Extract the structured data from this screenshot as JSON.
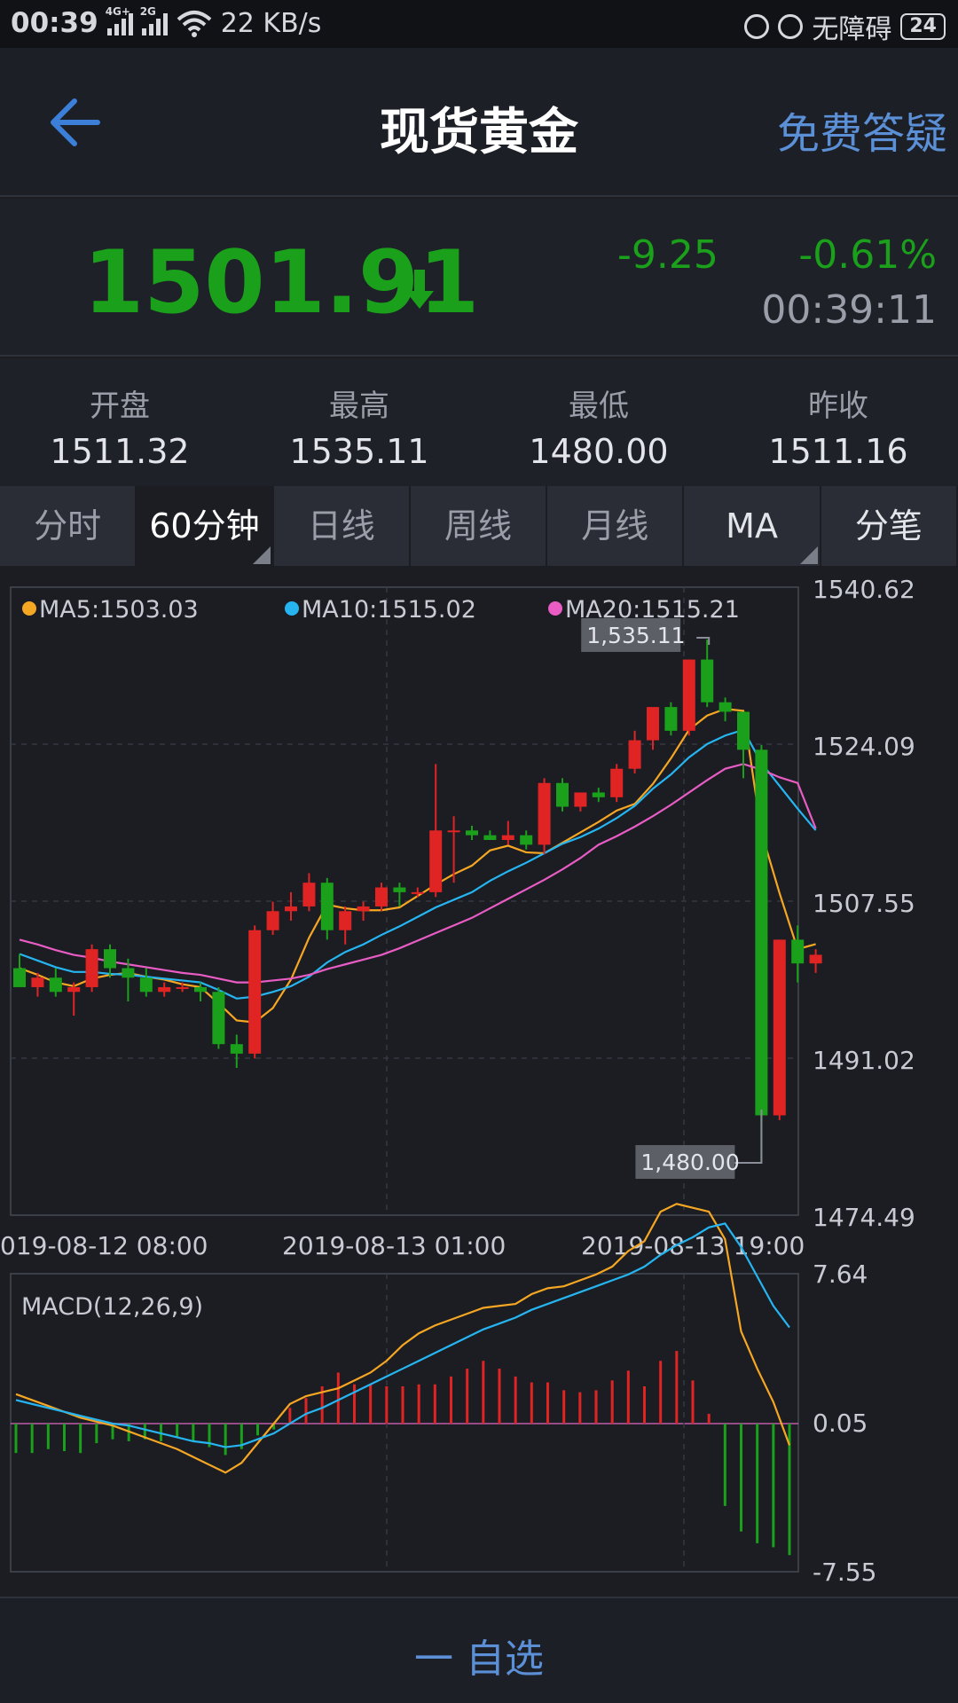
{
  "status_bar": {
    "time": "00:39",
    "network1": "4G+",
    "network2": "2G",
    "speed": "22 KB/s",
    "accessibility": "无障碍",
    "battery": "24"
  },
  "header": {
    "title": "现货黄金",
    "help_label": "免费答疑"
  },
  "quote": {
    "price": "1501.91",
    "change": "-9.25",
    "change_pct": "-0.61%",
    "time": "00:39:11",
    "down_color": "#1aa01a"
  },
  "stats": [
    {
      "label": "开盘",
      "value": "1511.32"
    },
    {
      "label": "最高",
      "value": "1535.11"
    },
    {
      "label": "最低",
      "value": "1480.00"
    },
    {
      "label": "昨收",
      "value": "1511.16"
    }
  ],
  "tabs": [
    {
      "label": "分时"
    },
    {
      "label": "60分钟"
    },
    {
      "label": "日线"
    },
    {
      "label": "周线"
    },
    {
      "label": "月线"
    },
    {
      "label": "MA"
    },
    {
      "label": "分笔"
    }
  ],
  "chart_data": [
    {
      "type": "candlestick",
      "legend": [
        {
          "label": "MA5:1503.03",
          "color": "#f5a623"
        },
        {
          "label": "MA10:1515.02",
          "color": "#26b5f0"
        },
        {
          "label": "MA20:1515.21",
          "color": "#e85cc4"
        }
      ],
      "y_ticks": [
        "1540.62",
        "1524.09",
        "1507.55",
        "1491.02",
        "1474.49"
      ],
      "ylim": [
        1474.49,
        1540.62
      ],
      "x_ticks": [
        "019-08-12 08:00",
        "2019-08-13 01:00",
        "2019-08-13 19:00"
      ],
      "max_label": "1,535.11",
      "min_label": "1,480.00",
      "up_color": "#e02424",
      "down_color": "#1aa01a",
      "candles": [
        [
          1500.5,
          1502.0,
          1499.0,
          1498.5
        ],
        [
          1498.5,
          1500.0,
          1497.5,
          1499.5
        ],
        [
          1499.5,
          1500.5,
          1497.5,
          1498.0
        ],
        [
          1498.0,
          1499.0,
          1495.5,
          1498.5
        ],
        [
          1498.5,
          1503.0,
          1498.0,
          1502.5
        ],
        [
          1502.5,
          1503.0,
          1499.5,
          1500.5
        ],
        [
          1500.5,
          1501.5,
          1497.0,
          1499.5
        ],
        [
          1499.5,
          1500.5,
          1497.5,
          1498.0
        ],
        [
          1498.0,
          1499.0,
          1497.5,
          1498.5
        ],
        [
          1498.5,
          1499.0,
          1498.0,
          1498.5
        ],
        [
          1498.5,
          1499.0,
          1497.0,
          1498.0
        ],
        [
          1498.0,
          1498.5,
          1492.0,
          1492.5
        ],
        [
          1492.5,
          1493.5,
          1490.0,
          1491.5
        ],
        [
          1491.5,
          1505.0,
          1491.0,
          1504.5
        ],
        [
          1504.5,
          1507.5,
          1504.0,
          1506.5
        ],
        [
          1506.5,
          1508.5,
          1505.5,
          1507.0
        ],
        [
          1507.0,
          1510.5,
          1506.5,
          1509.5
        ],
        [
          1509.5,
          1510.0,
          1503.5,
          1504.5
        ],
        [
          1504.5,
          1507.0,
          1503.0,
          1506.5
        ],
        [
          1506.5,
          1507.5,
          1505.5,
          1507.0
        ],
        [
          1507.0,
          1509.5,
          1506.5,
          1509.0
        ],
        [
          1509.0,
          1509.5,
          1507.0,
          1508.5
        ],
        [
          1508.5,
          1509.0,
          1508.0,
          1508.5
        ],
        [
          1508.5,
          1522.0,
          1508.0,
          1515.0
        ],
        [
          1515.0,
          1516.5,
          1509.5,
          1515.0
        ],
        [
          1515.0,
          1515.5,
          1514.0,
          1514.5
        ],
        [
          1514.5,
          1515.0,
          1514.0,
          1514.0
        ],
        [
          1514.0,
          1516.0,
          1513.5,
          1514.5
        ],
        [
          1514.5,
          1515.0,
          1513.0,
          1513.5
        ],
        [
          1513.5,
          1520.5,
          1512.5,
          1520.0
        ],
        [
          1520.0,
          1520.5,
          1517.0,
          1517.5
        ],
        [
          1517.5,
          1519.0,
          1517.0,
          1519.0
        ],
        [
          1519.0,
          1519.5,
          1518.0,
          1518.5
        ],
        [
          1518.5,
          1522.0,
          1518.0,
          1521.5
        ],
        [
          1521.5,
          1525.5,
          1521.0,
          1524.5
        ],
        [
          1524.5,
          1526.0,
          1523.5,
          1528.0
        ],
        [
          1528.0,
          1528.5,
          1525.0,
          1525.5
        ],
        [
          1525.5,
          1533.0,
          1525.0,
          1533.0
        ],
        [
          1533.0,
          1535.11,
          1528.0,
          1528.5
        ],
        [
          1528.5,
          1529.0,
          1526.5,
          1527.5
        ],
        [
          1527.5,
          1527.5,
          1520.5,
          1523.5
        ],
        [
          1523.5,
          1524.0,
          1480.0,
          1485.0
        ],
        [
          1485.0,
          1503.5,
          1484.5,
          1503.5
        ],
        [
          1503.5,
          1505.0,
          1499.0,
          1501.0
        ],
        [
          1501.0,
          1502.5,
          1500.0,
          1501.91
        ]
      ],
      "ma5": [
        1500.5,
        1499.8,
        1499.0,
        1498.6,
        1499.4,
        1499.8,
        1500.0,
        1499.6,
        1499.3,
        1498.8,
        1498.5,
        1496.8,
        1495.0,
        1494.8,
        1496.3,
        1499.3,
        1503.7,
        1507.2,
        1506.8,
        1506.6,
        1506.6,
        1506.9,
        1508.1,
        1509.3,
        1510.4,
        1511.3,
        1512.9,
        1513.4,
        1512.7,
        1512.6,
        1513.7,
        1514.8,
        1515.9,
        1517.1,
        1517.8,
        1519.9,
        1522.6,
        1525.6,
        1527.1,
        1527.8,
        1527.6,
        1514.8,
        1508.4,
        1502.5,
        1503.03
      ],
      "ma10": [
        1502.0,
        1501.3,
        1500.6,
        1500.1,
        1500.1,
        1499.9,
        1499.8,
        1499.6,
        1499.4,
        1499.2,
        1499.0,
        1498.2,
        1497.3,
        1497.5,
        1498.0,
        1498.6,
        1499.6,
        1501.1,
        1502.2,
        1503.0,
        1504.0,
        1504.9,
        1505.9,
        1506.9,
        1507.7,
        1508.5,
        1509.7,
        1510.7,
        1511.6,
        1512.6,
        1513.6,
        1514.3,
        1515.2,
        1516.3,
        1517.6,
        1519.4,
        1520.9,
        1522.7,
        1524.1,
        1525.0,
        1525.6,
        1522.1,
        1519.7,
        1517.3,
        1515.02
      ],
      "ma20": [
        1503.5,
        1503.0,
        1502.4,
        1501.9,
        1501.6,
        1501.2,
        1500.9,
        1500.6,
        1500.3,
        1500.0,
        1499.8,
        1499.4,
        1499.0,
        1499.0,
        1499.2,
        1499.4,
        1499.8,
        1500.4,
        1500.9,
        1501.4,
        1501.9,
        1502.6,
        1503.4,
        1504.2,
        1505.0,
        1505.8,
        1506.8,
        1507.8,
        1508.8,
        1509.8,
        1510.9,
        1512.1,
        1513.5,
        1514.4,
        1515.4,
        1516.5,
        1517.7,
        1519.0,
        1520.3,
        1521.5,
        1522.0,
        1521.4,
        1520.6,
        1520.0,
        1515.21
      ]
    },
    {
      "type": "macd",
      "title": "MACD(12,26,9)",
      "y_ticks": [
        "7.64",
        "0.05",
        "-7.55"
      ],
      "ylim": [
        -7.55,
        7.64
      ],
      "dif": [
        1.5,
        1.2,
        0.9,
        0.6,
        0.3,
        0.1,
        -0.1,
        -0.4,
        -0.7,
        -1.0,
        -1.3,
        -1.7,
        -2.1,
        -2.5,
        -2.0,
        -1.0,
        0.0,
        1.0,
        1.4,
        1.6,
        1.8,
        2.2,
        2.6,
        3.2,
        4.0,
        4.6,
        5.0,
        5.3,
        5.6,
        5.9,
        6.0,
        6.1,
        6.6,
        6.9,
        7.0,
        7.3,
        7.6,
        8.0,
        8.8,
        9.3,
        10.8,
        11.2,
        11.0,
        10.8,
        9.4,
        4.7,
        2.8,
        1.1,
        -1.1
      ],
      "dea": [
        1.2,
        1.0,
        0.8,
        0.6,
        0.4,
        0.2,
        0.0,
        -0.1,
        -0.3,
        -0.5,
        -0.7,
        -0.9,
        -1.0,
        -1.2,
        -1.1,
        -0.8,
        -0.5,
        0.0,
        0.5,
        0.8,
        1.2,
        1.6,
        2.0,
        2.4,
        2.8,
        3.2,
        3.6,
        4.0,
        4.4,
        4.8,
        5.1,
        5.4,
        5.8,
        6.1,
        6.4,
        6.7,
        7.0,
        7.3,
        7.6,
        8.0,
        8.6,
        9.1,
        9.5,
        10.0,
        10.2,
        9.0,
        7.5,
        6.0,
        4.9
      ],
      "hist": [
        -1.5,
        -1.5,
        -1.3,
        -1.4,
        -1.5,
        -1.0,
        -0.8,
        -0.9,
        -0.8,
        -0.9,
        -0.7,
        -0.9,
        -1.2,
        -1.6,
        -1.3,
        -0.6,
        -0.3,
        0.8,
        1.3,
        1.9,
        2.6,
        2.0,
        2.0,
        1.9,
        1.9,
        2.0,
        2.0,
        2.4,
        2.8,
        3.2,
        2.8,
        2.4,
        2.1,
        2.1,
        1.7,
        1.6,
        1.7,
        2.2,
        2.7,
        1.9,
        3.2,
        3.7,
        2.2,
        0.5,
        -4.2,
        -5.5,
        -6.1,
        -6.3,
        -6.7
      ]
    }
  ],
  "bottom_bar": {
    "favorite_label": "一  自选"
  }
}
